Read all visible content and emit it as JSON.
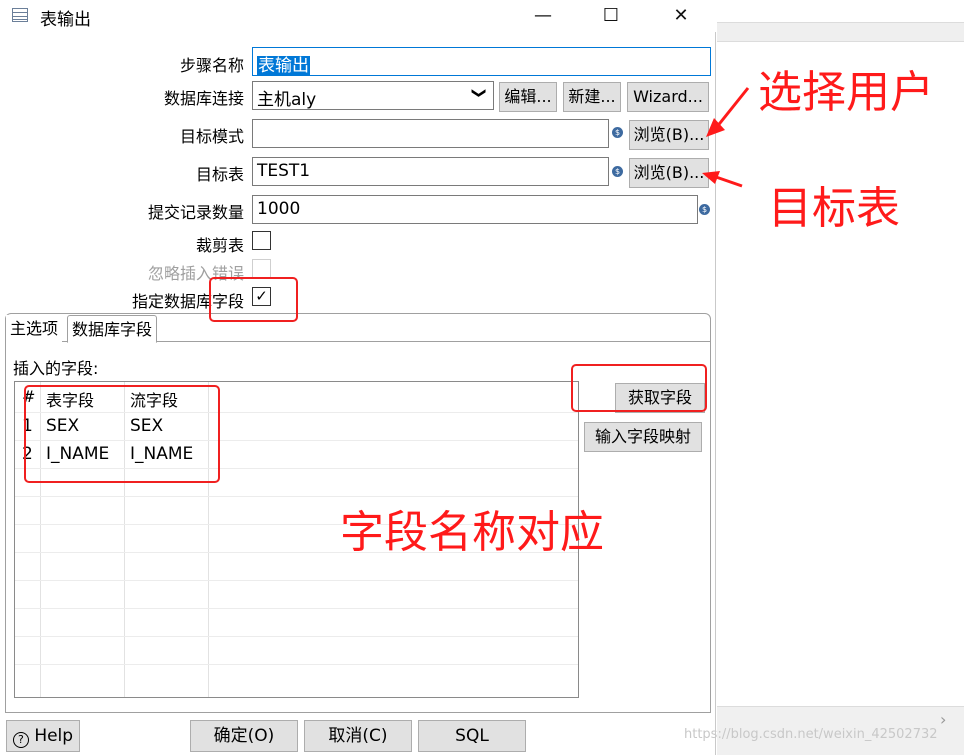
{
  "window": {
    "title": "表输出",
    "minimize": "—",
    "maximize": "☐",
    "close": "✕"
  },
  "form": {
    "step_name_label": "步骤名称",
    "step_name_value": "表输出",
    "connection_label": "数据库连接",
    "connection_value": "主机aly",
    "edit_button": "编辑...",
    "new_button": "新建...",
    "wizard_button": "Wizard...",
    "schema_label": "目标模式",
    "schema_value": "",
    "browse_schema_button": "浏览(B)...",
    "target_table_label": "目标表",
    "target_table_value": "TEST1",
    "browse_table_button": "浏览(B)...",
    "commit_size_label": "提交记录数量",
    "commit_size_value": "1000",
    "truncate_label": "裁剪表",
    "truncate_checked": false,
    "ignore_errors_label": "忽略插入错误",
    "ignore_errors_checked": false,
    "specify_fields_label": "指定数据库字段",
    "specify_fields_checked": true,
    "check_mark": "✓"
  },
  "tabs": [
    {
      "label": "主选项",
      "active": false
    },
    {
      "label": "数据库字段",
      "active": true
    }
  ],
  "fields_panel": {
    "caption": "插入的字段:",
    "columns": [
      "#",
      "表字段",
      "流字段"
    ],
    "rows": [
      {
        "n": "1",
        "table_field": "SEX",
        "stream_field": "SEX"
      },
      {
        "n": "2",
        "table_field": "I_NAME",
        "stream_field": "I_NAME"
      }
    ],
    "get_fields_button": "获取字段",
    "mapping_button": "输入字段映射"
  },
  "footer": {
    "help_button": "Help",
    "ok_button": "确定(O)",
    "cancel_button": "取消(C)",
    "sql_button": "SQL"
  },
  "annotations": {
    "choose_user": "选择用户",
    "target_table": "目标表",
    "field_mapping": "字段名称对应",
    "color": "#ff1a1a"
  },
  "watermark": "https://blog.csdn.net/weixin_42502732",
  "icons": {
    "variable": "$",
    "dropdown": "❯",
    "help": "?",
    "chevron": "›"
  }
}
